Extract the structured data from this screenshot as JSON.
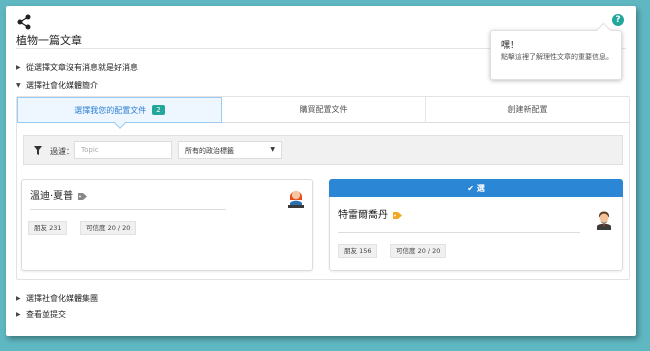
{
  "header": {
    "title": "植物一篇文章",
    "share_icon": "share-icon",
    "help_icon": "help-icon",
    "help_glyph": "?"
  },
  "tooltip": {
    "title": "嘿！",
    "text": "點擊這裡了解理性文章的重要信息。"
  },
  "sections": {
    "no_message": "從選擇文章沒有消息就是好消息",
    "profile_intro": "選擇社會化媒體簡介",
    "profile_groups": "選擇社會化媒體集團",
    "review_submit": "查看並提交"
  },
  "tabs": [
    {
      "label": "選擇我您的配置文件",
      "badge": "2",
      "active": true
    },
    {
      "label": "購買配置文件",
      "active": false
    },
    {
      "label": "創建新配置",
      "active": false
    }
  ],
  "filter": {
    "label": "過濾：",
    "topic_placeholder": "Topic",
    "tag_select_value": "所有的政治標籤"
  },
  "profiles": [
    {
      "name": "溫迪·夏普",
      "selected": false,
      "friends": "朋友 231",
      "credibility": "可信度 20 / 20",
      "avatar": "female-avatar"
    },
    {
      "name": "特雷爾喬丹",
      "selected": true,
      "selected_label": "✔ 選",
      "friends": "朋友 156",
      "credibility": "可信度 20 / 20",
      "avatar": "male-avatar"
    }
  ],
  "colors": {
    "teal": "#22a89b",
    "selected_blue": "#2b87d6",
    "tag_orange": "#f5a623",
    "background": "#5fb7c2"
  }
}
